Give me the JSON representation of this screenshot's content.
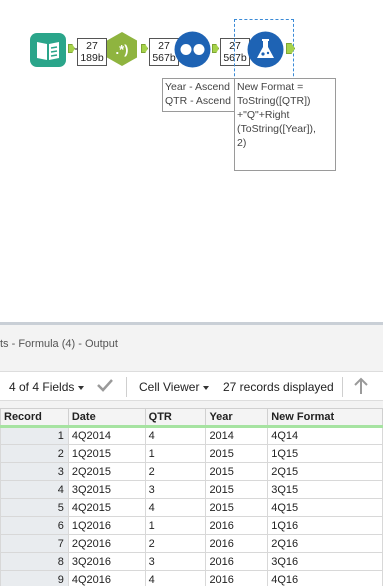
{
  "canvas": {
    "input_tool": {
      "icon": "book-icon"
    },
    "multirow_tool": {
      "icon": "regex-icon"
    },
    "sort_tool": {
      "icon": "dots-icon"
    },
    "formula_tool": {
      "icon": "flask-icon"
    },
    "badge1": {
      "count": "27",
      "size": "189b"
    },
    "badge2": {
      "count": "27",
      "size": "567b"
    },
    "badge3": {
      "count": "27",
      "size": "567b"
    },
    "sort_annotation": "Year - Ascend\nQTR - Ascend",
    "formula_annotation": "New Format =\nToString([QTR])\n+\"Q\"+Right\n(ToString([Year]),\n2)"
  },
  "results": {
    "title": "ts - Formula (4) - Output",
    "fields_label": "4 of 4 Fields",
    "viewer_label": "Cell Viewer",
    "records_label": "27 records displayed",
    "columns": [
      "Record",
      "Date",
      "QTR",
      "Year",
      "New Format"
    ],
    "rows": [
      {
        "record": "1",
        "date": "4Q2014",
        "qtr": "4",
        "year": "2014",
        "fmt": "4Q14"
      },
      {
        "record": "2",
        "date": "1Q2015",
        "qtr": "1",
        "year": "2015",
        "fmt": "1Q15"
      },
      {
        "record": "3",
        "date": "2Q2015",
        "qtr": "2",
        "year": "2015",
        "fmt": "2Q15"
      },
      {
        "record": "4",
        "date": "3Q2015",
        "qtr": "3",
        "year": "2015",
        "fmt": "3Q15"
      },
      {
        "record": "5",
        "date": "4Q2015",
        "qtr": "4",
        "year": "2015",
        "fmt": "4Q15"
      },
      {
        "record": "6",
        "date": "1Q2016",
        "qtr": "1",
        "year": "2016",
        "fmt": "1Q16"
      },
      {
        "record": "7",
        "date": "2Q2016",
        "qtr": "2",
        "year": "2016",
        "fmt": "2Q16"
      },
      {
        "record": "8",
        "date": "3Q2016",
        "qtr": "3",
        "year": "2016",
        "fmt": "3Q16"
      },
      {
        "record": "9",
        "date": "4Q2016",
        "qtr": "4",
        "year": "2016",
        "fmt": "4Q16"
      }
    ]
  },
  "colors": {
    "accent_green": "#a6d24a",
    "sort_blue": "#1e63b4",
    "input_teal": "#2aa58a",
    "multirow_olive": "#8fb43f"
  }
}
